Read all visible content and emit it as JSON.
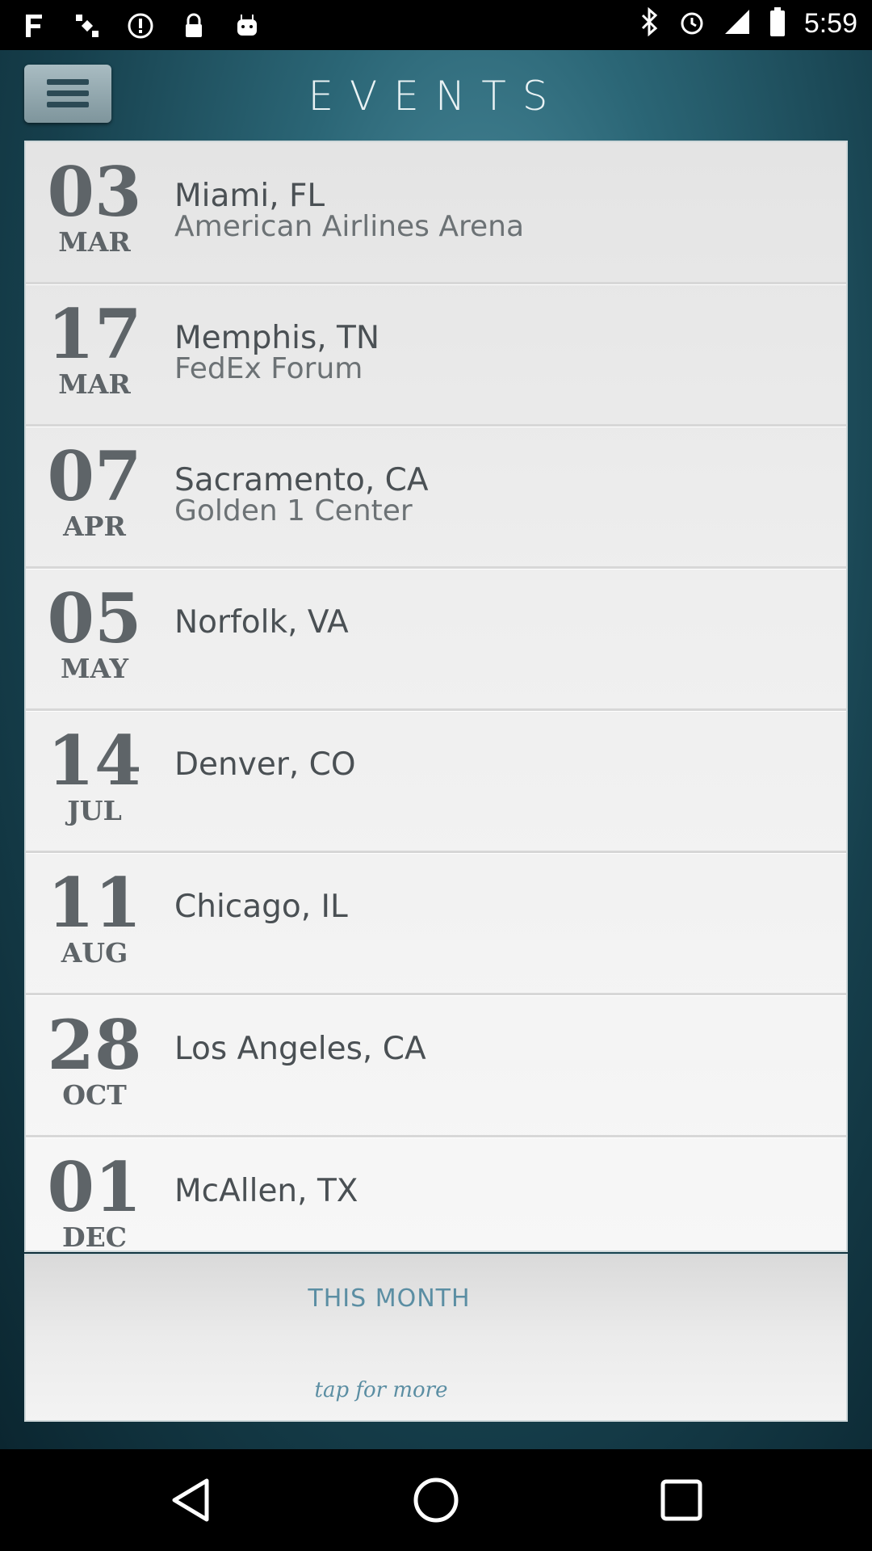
{
  "status_bar": {
    "time": "5:59",
    "left_icons": [
      "fake-gps-icon",
      "satellite-icon",
      "sync-icon",
      "lock-icon",
      "android-icon"
    ],
    "right_icons": [
      "bluetooth-icon",
      "alarm-icon",
      "signal-icon",
      "battery-icon"
    ]
  },
  "header": {
    "title": "EVENTS",
    "menu_icon": "hamburger-menu-icon"
  },
  "events": [
    {
      "day": "03",
      "month": "MAR",
      "city": "Miami, FL",
      "venue": "American Airlines Arena"
    },
    {
      "day": "17",
      "month": "MAR",
      "city": "Memphis, TN",
      "venue": "FedEx Forum"
    },
    {
      "day": "07",
      "month": "APR",
      "city": "Sacramento, CA",
      "venue": "Golden 1 Center"
    },
    {
      "day": "05",
      "month": "MAY",
      "city": "Norfolk, VA",
      "venue": ""
    },
    {
      "day": "14",
      "month": "JUL",
      "city": "Denver, CO",
      "venue": ""
    },
    {
      "day": "11",
      "month": "AUG",
      "city": "Chicago, IL",
      "venue": ""
    },
    {
      "day": "28",
      "month": "OCT",
      "city": "Los Angeles, CA",
      "venue": ""
    },
    {
      "day": "01",
      "month": "DEC",
      "city": "McAllen, TX",
      "venue": ""
    }
  ],
  "footer": {
    "this_month": "THIS MONTH",
    "tap_more": "tap for more"
  },
  "nav_bar": {
    "icons": [
      "back-icon",
      "home-icon",
      "recents-icon"
    ]
  },
  "colors": {
    "accent": "#5b8ea3",
    "text_dark": "#5e6468",
    "background_teal": "#2b6676"
  }
}
